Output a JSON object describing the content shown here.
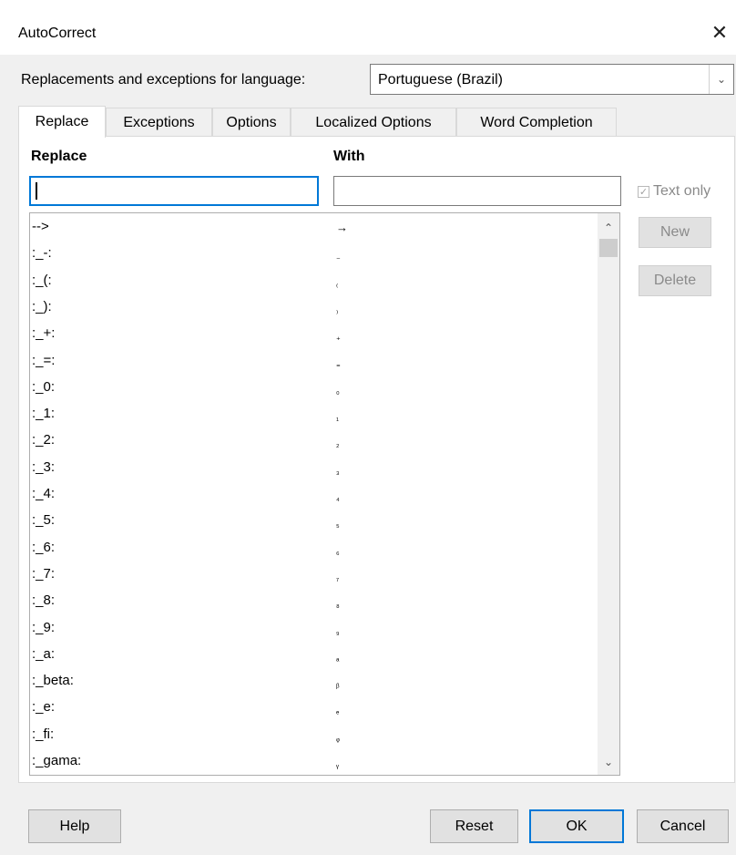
{
  "window": {
    "title": "AutoCorrect",
    "close_icon": "close-icon"
  },
  "language": {
    "label": "Replacements and exceptions for language:",
    "selected": "Portuguese (Brazil)"
  },
  "tabs": [
    {
      "label": "Replace",
      "active": true
    },
    {
      "label": "Exceptions"
    },
    {
      "label": "Options"
    },
    {
      "label": "Localized Options"
    },
    {
      "label": "Word Completion"
    }
  ],
  "replace": {
    "replace_header": "Replace",
    "with_header": "With",
    "replace_value": "",
    "with_value": "",
    "text_only_label": "Text only",
    "text_only_checked": true,
    "new_label": "New",
    "delete_label": "Delete",
    "entries": [
      {
        "k": "-->",
        "v": "→"
      },
      {
        "k": ":_-:",
        "v": "₋"
      },
      {
        "k": ":_(:",
        "v": "₍"
      },
      {
        "k": ":_):",
        "v": "₎"
      },
      {
        "k": ":_+:",
        "v": "₊"
      },
      {
        "k": ":_=:",
        "v": "₌"
      },
      {
        "k": ":_0:",
        "v": "₀"
      },
      {
        "k": ":_1:",
        "v": "₁"
      },
      {
        "k": ":_2:",
        "v": "₂"
      },
      {
        "k": ":_3:",
        "v": "₃"
      },
      {
        "k": ":_4:",
        "v": "₄"
      },
      {
        "k": ":_5:",
        "v": "₅"
      },
      {
        "k": ":_6:",
        "v": "₆"
      },
      {
        "k": ":_7:",
        "v": "₇"
      },
      {
        "k": ":_8:",
        "v": "₈"
      },
      {
        "k": ":_9:",
        "v": "₉"
      },
      {
        "k": ":_a:",
        "v": "ₐ"
      },
      {
        "k": ":_beta:",
        "v": "ᵦ"
      },
      {
        "k": ":_e:",
        "v": "ₑ"
      },
      {
        "k": ":_fi:",
        "v": "ᵩ"
      },
      {
        "k": ":_gama:",
        "v": "ᵧ"
      }
    ]
  },
  "footer": {
    "help": "Help",
    "reset": "Reset",
    "ok": "OK",
    "cancel": "Cancel"
  }
}
